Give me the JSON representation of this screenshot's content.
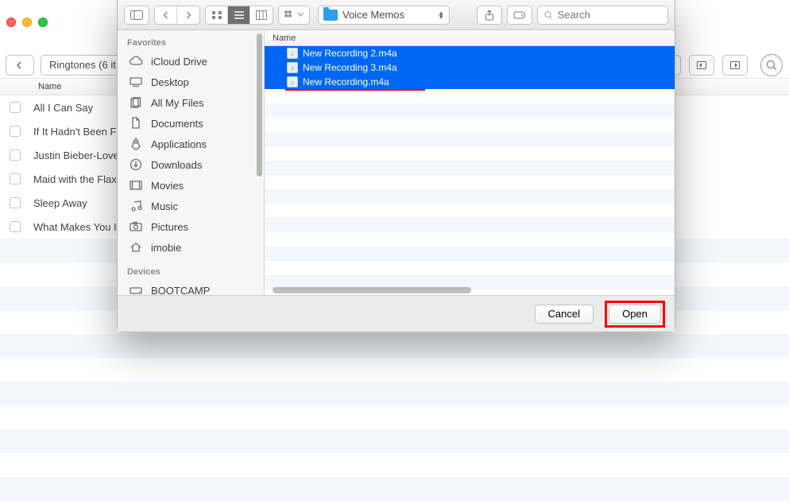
{
  "bg": {
    "breadcrumb": "Ringtones (6 it",
    "name_col": "Name",
    "rows": [
      {
        "name": "All I Can Say"
      },
      {
        "name": "If It Hadn't Been F"
      },
      {
        "name": "Justin Bieber-Love"
      },
      {
        "name": "Maid with the Flax"
      },
      {
        "name": "Sleep Away"
      },
      {
        "name": "What Makes You I"
      }
    ]
  },
  "dialog": {
    "path": "Voice Memos",
    "search_placeholder": "Search",
    "name_col": "Name",
    "sidebar": {
      "favorites_label": "Favorites",
      "devices_label": "Devices",
      "favorites": [
        {
          "label": "iCloud Drive",
          "icon": "cloud"
        },
        {
          "label": "Desktop",
          "icon": "desktop"
        },
        {
          "label": "All My Files",
          "icon": "allfiles"
        },
        {
          "label": "Documents",
          "icon": "doc"
        },
        {
          "label": "Applications",
          "icon": "apps"
        },
        {
          "label": "Downloads",
          "icon": "download"
        },
        {
          "label": "Movies",
          "icon": "movies"
        },
        {
          "label": "Music",
          "icon": "music"
        },
        {
          "label": "Pictures",
          "icon": "pictures"
        },
        {
          "label": "imobie",
          "icon": "home"
        }
      ],
      "devices": [
        {
          "label": "BOOTCAMP",
          "icon": "drive"
        }
      ]
    },
    "files": [
      {
        "name": "New Recording 2.m4a",
        "selected": true
      },
      {
        "name": "New Recording 3.m4a",
        "selected": true
      },
      {
        "name": "New Recording.m4a",
        "selected": true
      }
    ],
    "footer": {
      "cancel": "Cancel",
      "open": "Open"
    }
  }
}
